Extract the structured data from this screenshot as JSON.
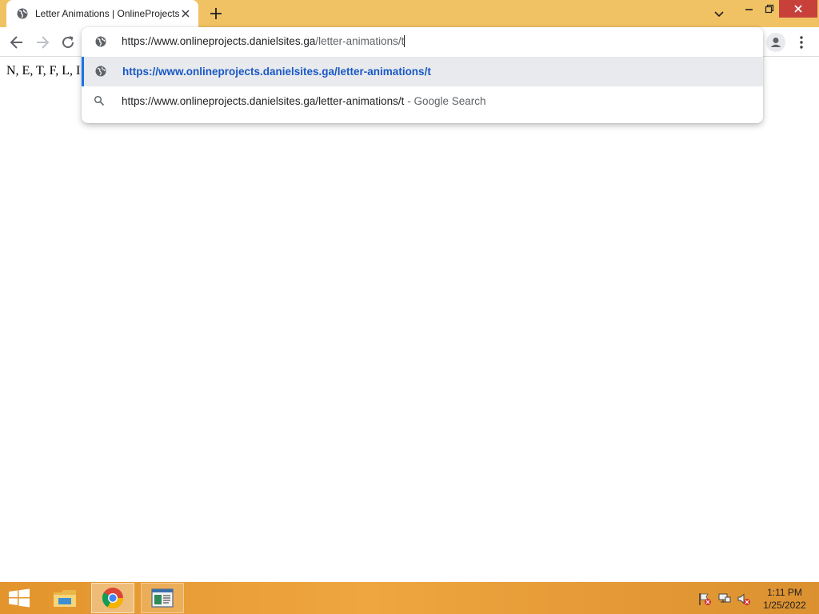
{
  "browser": {
    "tab_title": "Letter Animations | OnlineProjects",
    "colors": {
      "frame": "#f1c263",
      "close_button": "#c7413a",
      "suggestion_highlight": "#e8eaed",
      "link_blue": "#1a58c4"
    }
  },
  "omnibox": {
    "input_host": "https://www.onlineprojects.danielsites.ga",
    "input_path": "/letter-animations/t",
    "suggestions": [
      {
        "icon": "globe-icon",
        "text": "https://www.onlineprojects.danielsites.ga/letter-animations/t"
      },
      {
        "icon": "search-icon",
        "text": "https://www.onlineprojects.danielsites.ga/letter-animations/t",
        "separator": " - ",
        "description": "Google Search"
      }
    ]
  },
  "page": {
    "content_text": "N, E, T, F, L, I"
  },
  "taskbar": {
    "apps": [
      "file-explorer-icon",
      "chrome-icon",
      "app-window-icon"
    ],
    "clock_time": "1:11 PM",
    "clock_date": "1/25/2022"
  }
}
